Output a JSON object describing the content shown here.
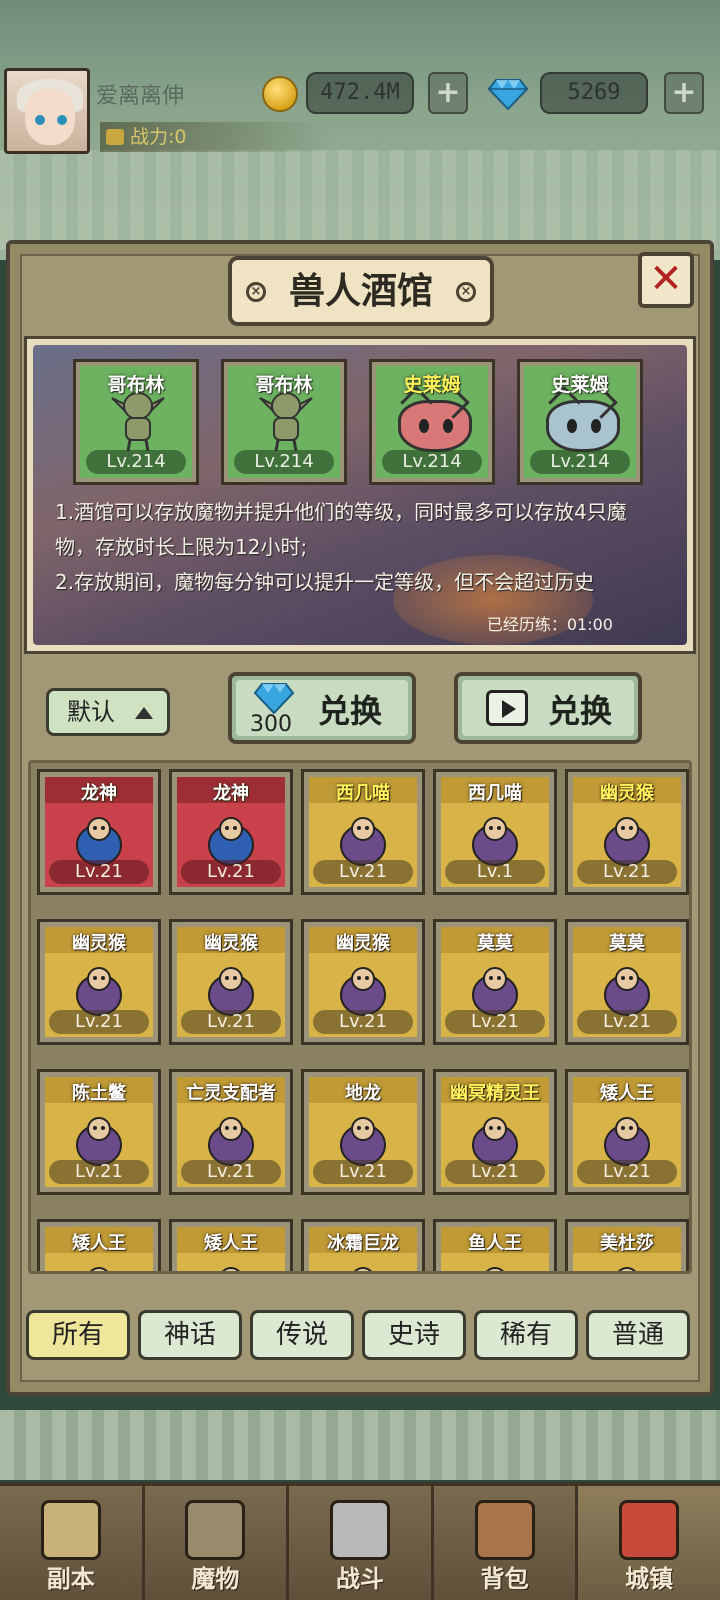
{
  "player": {
    "name": "爱离离伸",
    "power_label": "战力:0",
    "gold": "472.4M",
    "gems": "5269",
    "plus_label": "+"
  },
  "panel": {
    "title": "兽人酒馆",
    "close_label": "✕"
  },
  "tavern": {
    "slots": [
      {
        "name": "哥布林",
        "level": "Lv.214",
        "kind": "goblin",
        "name_color": "white"
      },
      {
        "name": "哥布林",
        "level": "Lv.214",
        "kind": "goblin",
        "name_color": "white"
      },
      {
        "name": "史莱姆",
        "level": "Lv.214",
        "kind": "slime-red",
        "name_color": "yellow"
      },
      {
        "name": "史莱姆",
        "level": "Lv.214",
        "kind": "slime-blue",
        "name_color": "white"
      }
    ],
    "rules_line1": "1.酒馆可以存放魔物并提升他们的等级，同时最多可以存放4只魔物，存放时长上限为12小时;",
    "rules_line2": "2.存放期间，魔物每分钟可以提升一定等级，但不会超过历史",
    "elapsed": "已经历练：01:00"
  },
  "controls": {
    "sort_label": "默认",
    "exchange_gem_cost": "300",
    "exchange_gem_label": "兑换",
    "exchange_ad_label": "兑换"
  },
  "monsters": [
    {
      "name": "龙神",
      "level": "Lv.21",
      "rarity": "myth",
      "name_color": "white"
    },
    {
      "name": "龙神",
      "level": "Lv.21",
      "rarity": "myth",
      "name_color": "white"
    },
    {
      "name": "西几喵",
      "level": "Lv.21",
      "rarity": "legend",
      "name_color": "yellow"
    },
    {
      "name": "西几喵",
      "level": "Lv.1",
      "rarity": "legend",
      "name_color": "white"
    },
    {
      "name": "幽灵猴",
      "level": "Lv.21",
      "rarity": "legend",
      "name_color": "yellow"
    },
    {
      "name": "幽灵猴",
      "level": "Lv.21",
      "rarity": "legend",
      "name_color": "white"
    },
    {
      "name": "幽灵猴",
      "level": "Lv.21",
      "rarity": "legend",
      "name_color": "white"
    },
    {
      "name": "幽灵猴",
      "level": "Lv.21",
      "rarity": "legend",
      "name_color": "white"
    },
    {
      "name": "莫莫",
      "level": "Lv.21",
      "rarity": "legend",
      "name_color": "white"
    },
    {
      "name": "莫莫",
      "level": "Lv.21",
      "rarity": "legend",
      "name_color": "white"
    },
    {
      "name": "陈土鳖",
      "level": "Lv.21",
      "rarity": "legend",
      "name_color": "white"
    },
    {
      "name": "亡灵支配者",
      "level": "Lv.21",
      "rarity": "legend",
      "name_color": "white"
    },
    {
      "name": "地龙",
      "level": "Lv.21",
      "rarity": "legend",
      "name_color": "white"
    },
    {
      "name": "幽冥精灵王",
      "level": "Lv.21",
      "rarity": "legend",
      "name_color": "yellow"
    },
    {
      "name": "矮人王",
      "level": "Lv.21",
      "rarity": "legend",
      "name_color": "white"
    },
    {
      "name": "矮人王",
      "level": "",
      "rarity": "legend",
      "name_color": "white"
    },
    {
      "name": "矮人王",
      "level": "",
      "rarity": "legend",
      "name_color": "white"
    },
    {
      "name": "冰霜巨龙",
      "level": "",
      "rarity": "legend",
      "name_color": "white"
    },
    {
      "name": "鱼人王",
      "level": "",
      "rarity": "legend",
      "name_color": "white"
    },
    {
      "name": "美杜莎",
      "level": "",
      "rarity": "legend",
      "name_color": "white"
    }
  ],
  "filters": [
    {
      "label": "所有",
      "active": true
    },
    {
      "label": "神话",
      "active": false
    },
    {
      "label": "传说",
      "active": false
    },
    {
      "label": "史诗",
      "active": false
    },
    {
      "label": "稀有",
      "active": false
    },
    {
      "label": "普通",
      "active": false
    }
  ],
  "nav": [
    {
      "label": "副本",
      "icon": "map-scroll-icon"
    },
    {
      "label": "魔物",
      "icon": "monster-helmet-icon"
    },
    {
      "label": "战斗",
      "icon": "crossed-swords-icon"
    },
    {
      "label": "背包",
      "icon": "backpack-icon"
    },
    {
      "label": "城镇",
      "icon": "town-shop-icon"
    }
  ],
  "colors": {
    "myth": "#c9424b",
    "legend": "#d8b347",
    "tavern_card": "#6cb260",
    "active_tab": "#eee69a"
  }
}
